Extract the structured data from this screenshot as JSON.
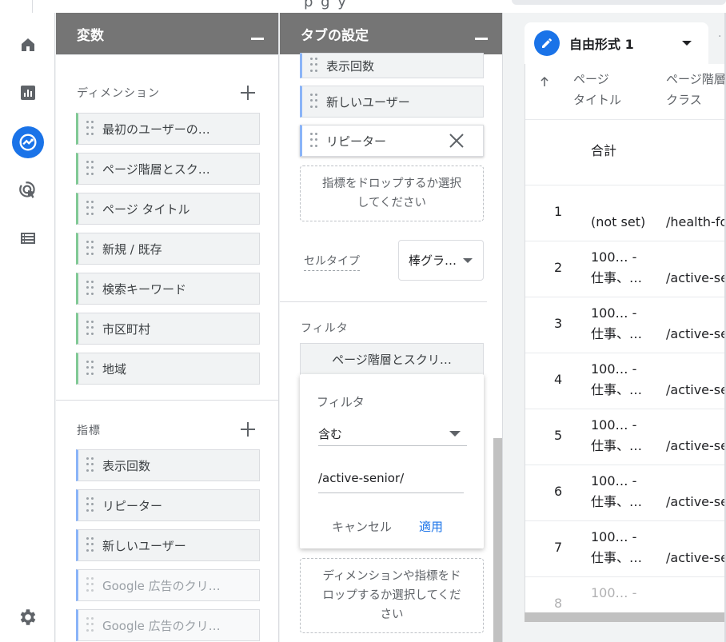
{
  "topbar": {
    "glyphs": "p g y"
  },
  "nav": {
    "items": [
      {
        "name": "home-icon"
      },
      {
        "name": "reports-icon"
      },
      {
        "name": "explore-icon",
        "active": true
      },
      {
        "name": "advertising-icon"
      },
      {
        "name": "configure-icon"
      }
    ],
    "settings": "gear-icon"
  },
  "variables": {
    "title": "変数",
    "dimensions_label": "ディメンション",
    "dimensions": [
      "最初のユーザーの…",
      "ページ階層とスク…",
      "ページ タイトル",
      "新規 / 既存",
      "検索キーワード",
      "市区町村",
      "地域"
    ],
    "metrics_label": "指標",
    "metrics": [
      "表示回数",
      "リピーター",
      "新しいユーザー"
    ],
    "faded_metrics": [
      "Google 広告のクリ…",
      "Google 広告のクリ…"
    ]
  },
  "tab_settings": {
    "title": "タブの設定",
    "value_chips": [
      "表示回数",
      "新しいユーザー",
      "リピーター"
    ],
    "metrics_drop": "指標をドロップするか選択\nしてください",
    "cell_type_label": "セルタイプ",
    "cell_type_value": "棒グラ…",
    "filter_label": "フィルタ",
    "filter_chip": "ページ階層とスクリ…",
    "filter_card": {
      "title": "フィルタ",
      "match_type": "含む",
      "expression": "/active-senior/",
      "cancel": "キャンセル",
      "apply": "適用"
    },
    "filter_drop": "ディメンションや指標をド\nロップするか選択してくだ\nさい"
  },
  "report": {
    "tab_label": "自由形式 1",
    "sort_icon": "arrow-up-icon",
    "col1": "ページ\nタイトル",
    "col2": "ページ階層\nクラス",
    "total_label": "合計",
    "rows": [
      {
        "n": "1",
        "title": "(not set)",
        "path": "/health-fo"
      },
      {
        "n": "2",
        "title": "100… -\n仕事、…",
        "path": "/active-se"
      },
      {
        "n": "3",
        "title": "100… -\n仕事、…",
        "path": "/active-se"
      },
      {
        "n": "4",
        "title": "100… -\n仕事、…",
        "path": "/active-se"
      },
      {
        "n": "5",
        "title": "100… -\n仕事、…",
        "path": "/active-se"
      },
      {
        "n": "6",
        "title": "100… -\n仕事、…",
        "path": "/active-se"
      },
      {
        "n": "7",
        "title": "100… -\n仕事、…",
        "path": "/active-se"
      },
      {
        "n": "8",
        "title": "100… -",
        "path": ""
      }
    ]
  }
}
